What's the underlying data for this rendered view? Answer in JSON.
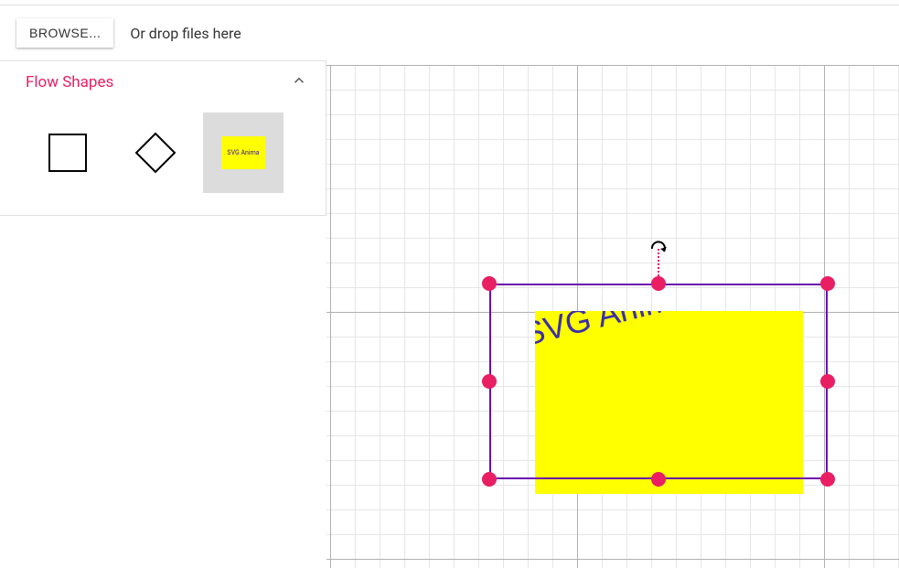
{
  "upload": {
    "browse_label": "BROWSE...",
    "drop_hint": "Or drop files here"
  },
  "palette": {
    "title": "Flow Shapes",
    "shapes": [
      {
        "name": "rectangle"
      },
      {
        "name": "diamond"
      },
      {
        "name": "svg-animation",
        "thumb_text": "SVG Anima"
      }
    ]
  },
  "canvas": {
    "selected_node": {
      "text": "SVG Animation"
    }
  }
}
